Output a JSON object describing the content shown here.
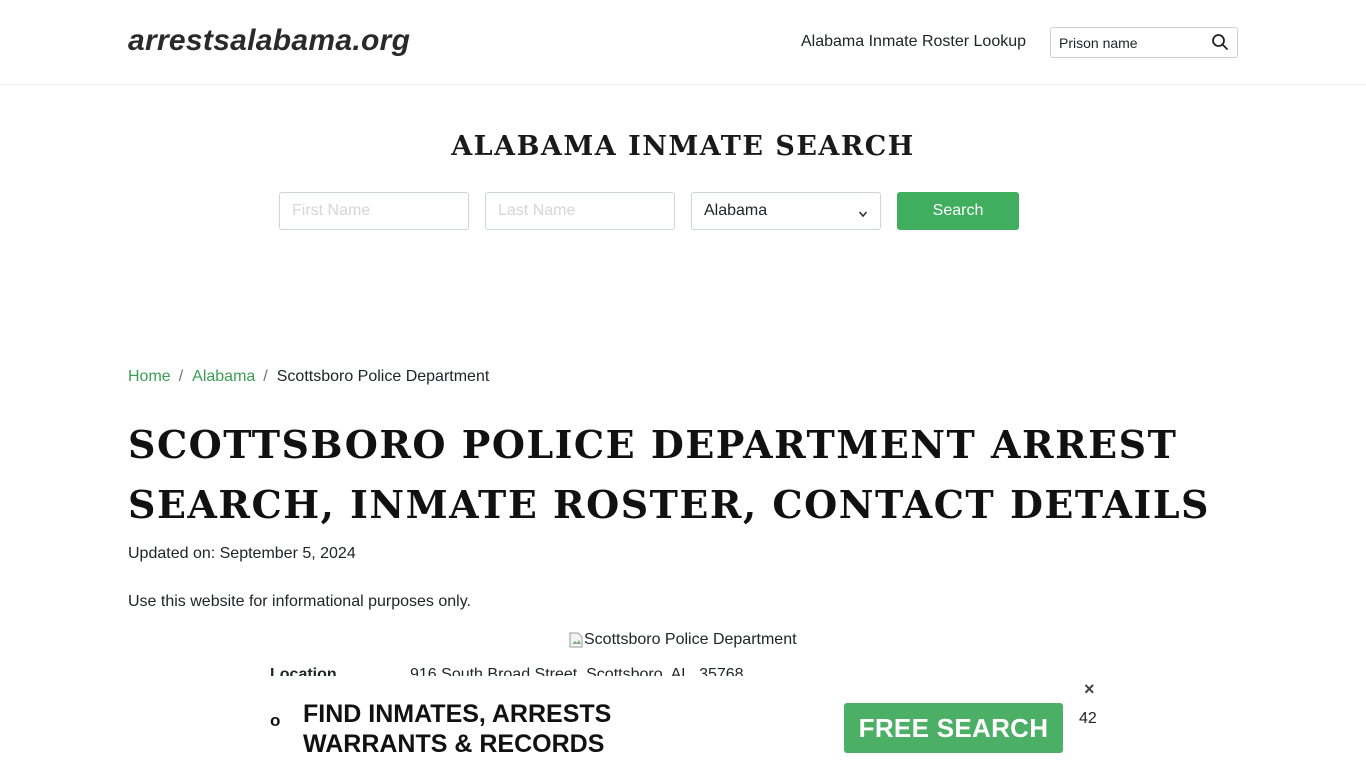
{
  "header": {
    "brand": "arrestsalabama.org",
    "nav_link": "Alabama Inmate Roster Lookup",
    "prison_search_placeholder": "Prison name",
    "search_icon": "search-icon"
  },
  "hero": {
    "title": "ALABAMA INMATE SEARCH",
    "first_name_placeholder": "First Name",
    "last_name_placeholder": "Last Name",
    "state_selected": "Alabama",
    "search_label": "Search",
    "accent_color": "#3fae5f"
  },
  "breadcrumb": {
    "home": "Home",
    "state": "Alabama",
    "current": "Scottsboro Police Department",
    "separator": "/"
  },
  "main": {
    "title": "SCOTTSBORO POLICE DEPARTMENT ARREST SEARCH, INMATE ROSTER, CONTACT DETAILS",
    "updated": "Updated on: September 5, 2024",
    "disclaimer": "Use this website for informational purposes only.",
    "image_alt": "Scottsboro Police Department",
    "location_label": "Location",
    "location_value": "916 South Broad Street, Scottsboro, AL, 35768"
  },
  "ad": {
    "bullet": "o",
    "headline_line1": "FIND INMATES, ARRESTS",
    "headline_line2": "WARRANTS & RECORDS",
    "cta": "FREE SEARCH",
    "close": "×",
    "peek": "42",
    "cta_color": "#4caf66"
  }
}
